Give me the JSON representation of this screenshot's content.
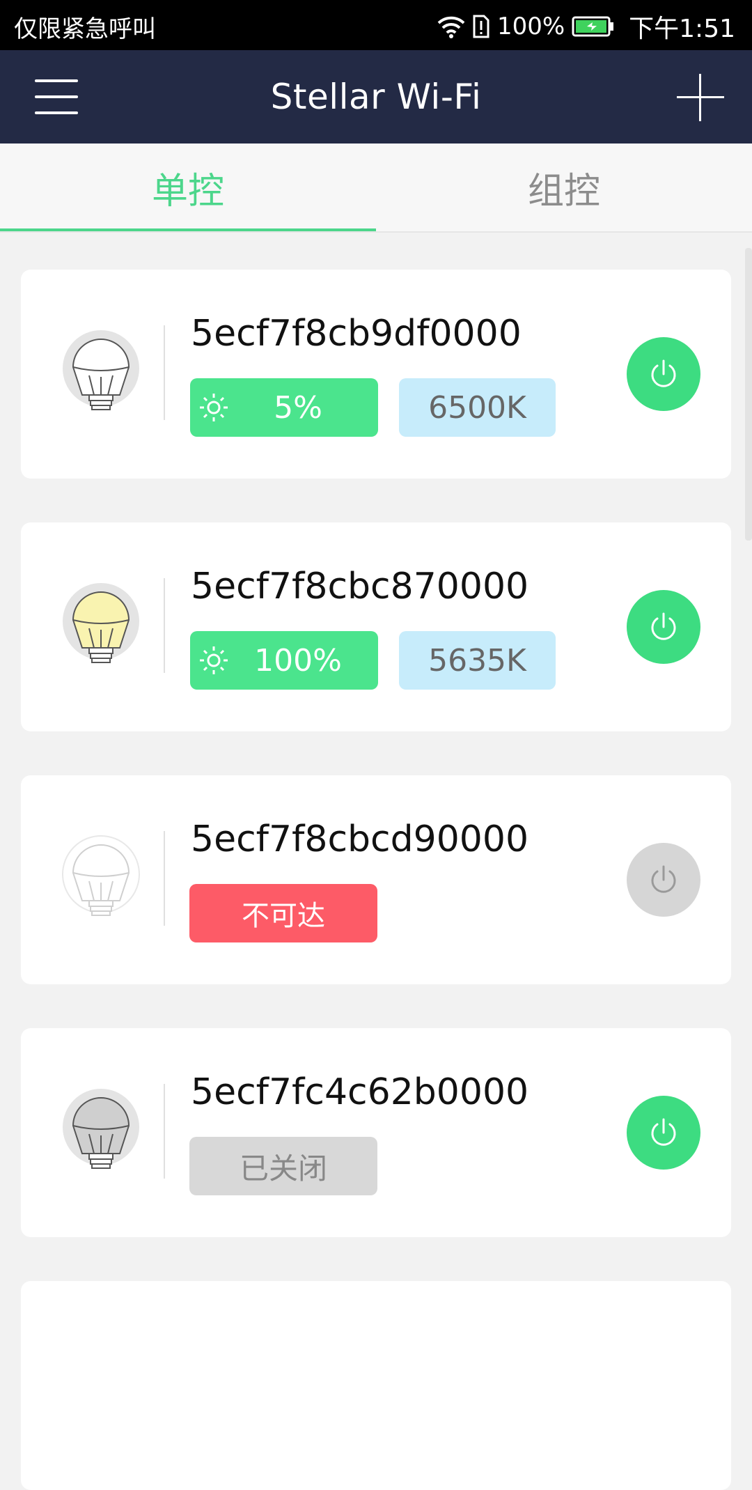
{
  "status_bar": {
    "carrier": "仅限紧急呼叫",
    "battery_percent": "100%",
    "time": "下午1:51"
  },
  "app_bar": {
    "title": "Stellar Wi-Fi"
  },
  "tabs": [
    {
      "label": "单控",
      "selected": true
    },
    {
      "label": "组控",
      "selected": false
    }
  ],
  "colors": {
    "accent": "#4cd68b",
    "app_bar_bg": "#232a45",
    "brightness_pill": "#4be48d",
    "temp_pill": "#c7ecfb",
    "unreachable_pill": "#fd5b67",
    "off_pill": "#d8d8d8",
    "power_on": "#3ddc81",
    "power_disabled": "#d6d6d6"
  },
  "devices": [
    {
      "name": "5ecf7f8cb9df0000",
      "state": "on",
      "brightness": "5%",
      "color_temp": "6500K",
      "bulb_color": "#ffffff",
      "power_icon": "power-icon"
    },
    {
      "name": "5ecf7f8cbc870000",
      "state": "on",
      "brightness": "100%",
      "color_temp": "5635K",
      "bulb_color": "#f9f3b0",
      "power_icon": "power-icon"
    },
    {
      "name": "5ecf7f8cbcd90000",
      "state": "unreachable",
      "status_label": "不可达",
      "bulb_color": "#ffffff",
      "power_icon": "power-icon"
    },
    {
      "name": "5ecf7fc4c62b0000",
      "state": "off",
      "status_label": "已关闭",
      "bulb_color": "#cfcfcf",
      "power_icon": "power-icon"
    }
  ]
}
